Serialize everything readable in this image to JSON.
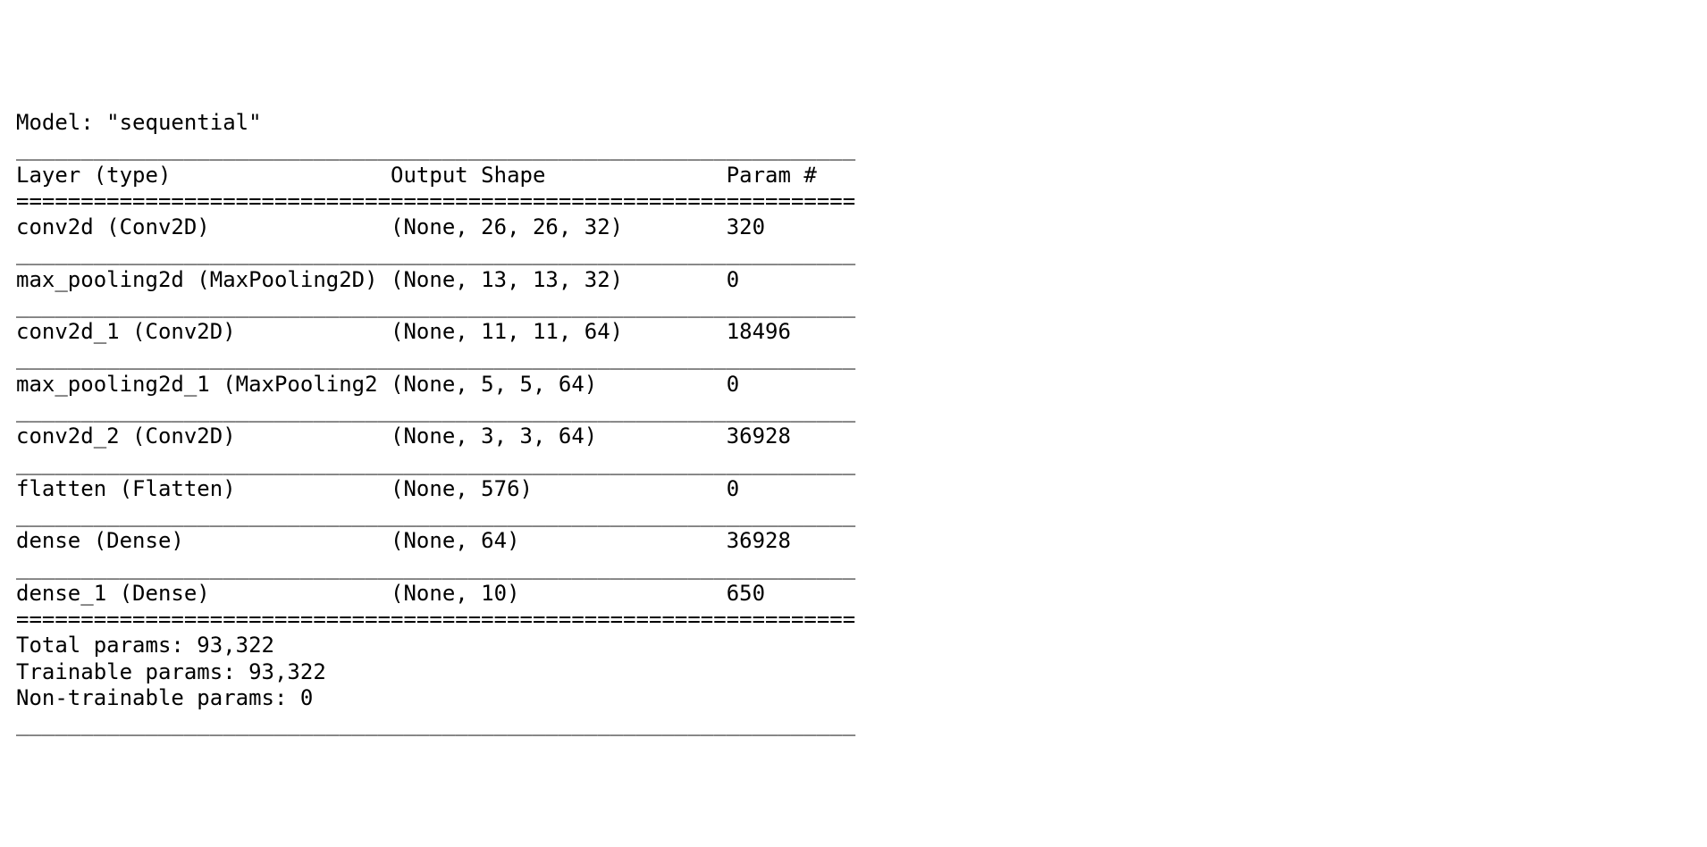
{
  "col_widths": {
    "layer": 29,
    "shape": 26,
    "param": 10
  },
  "title": "Model: \"sequential\"",
  "headers": {
    "layer": "Layer (type)",
    "shape": "Output Shape",
    "param": "Param #"
  },
  "layers": [
    {
      "layer": "conv2d (Conv2D)",
      "shape": "(None, 26, 26, 32)",
      "param": "320"
    },
    {
      "layer": "max_pooling2d (MaxPooling2D)",
      "shape": "(None, 13, 13, 32)",
      "param": "0"
    },
    {
      "layer": "conv2d_1 (Conv2D)",
      "shape": "(None, 11, 11, 64)",
      "param": "18496"
    },
    {
      "layer": "max_pooling2d_1 (MaxPooling2",
      "shape": "(None, 5, 5, 64)",
      "param": "0"
    },
    {
      "layer": "conv2d_2 (Conv2D)",
      "shape": "(None, 3, 3, 64)",
      "param": "36928"
    },
    {
      "layer": "flatten (Flatten)",
      "shape": "(None, 576)",
      "param": "0"
    },
    {
      "layer": "dense (Dense)",
      "shape": "(None, 64)",
      "param": "36928"
    },
    {
      "layer": "dense_1 (Dense)",
      "shape": "(None, 10)",
      "param": "650"
    }
  ],
  "footer": {
    "total": "Total params: 93,322",
    "trainable": "Trainable params: 93,322",
    "nontrain": "Non-trainable params: 0"
  }
}
